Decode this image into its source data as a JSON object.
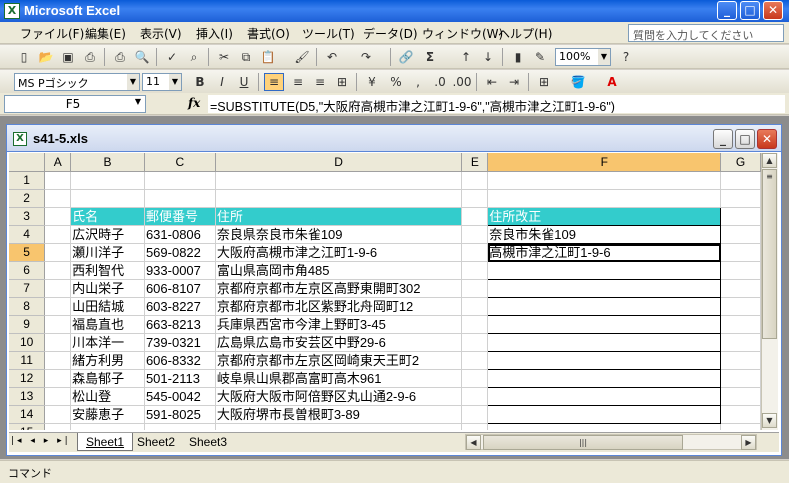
{
  "app": {
    "title": "Microsoft Excel",
    "help_placeholder": "質問を入力してください"
  },
  "menu": [
    "ファイル(F)",
    "編集(E)",
    "表示(V)",
    "挿入(I)",
    "書式(O)",
    "ツール(T)",
    "データ(D)",
    "ウィンドウ(W)",
    "ヘルプ(H)"
  ],
  "toolbar": {
    "zoom": "100%",
    "font_name": "MS Pゴシック",
    "font_size": "11"
  },
  "formula_bar": {
    "name_box": "F5",
    "fx": "fx",
    "formula": "=SUBSTITUTE(D5,\"大阪府高槻市津之江町1-9-6\",\"高槻市津之江町1-9-6\")"
  },
  "workbook": {
    "filename": "s41-5.xls"
  },
  "grid": {
    "columns": [
      "A",
      "B",
      "C",
      "D",
      "E",
      "F",
      "G"
    ],
    "selected_column": "F",
    "selected_row": "5",
    "headers": {
      "B": "氏名",
      "C": "郵便番号",
      "D": "住所",
      "F": "住所改正"
    },
    "rows": [
      {
        "n": "1",
        "B": "",
        "C": "",
        "D": "",
        "F": ""
      },
      {
        "n": "2",
        "B": "",
        "C": "",
        "D": "",
        "F": ""
      },
      {
        "n": "3",
        "B": "氏名",
        "C": "郵便番号",
        "D": "住所",
        "F": "住所改正"
      },
      {
        "n": "4",
        "B": "広沢時子",
        "C": "631-0806",
        "D": "奈良県奈良市朱雀109",
        "F": "奈良市朱雀109"
      },
      {
        "n": "5",
        "B": "瀬川洋子",
        "C": "569-0822",
        "D": "大阪府高槻市津之江町1-9-6",
        "F": "高槻市津之江町1-9-6"
      },
      {
        "n": "6",
        "B": "西利智代",
        "C": "933-0007",
        "D": "富山県高岡市角485",
        "F": ""
      },
      {
        "n": "7",
        "B": "内山栄子",
        "C": "606-8107",
        "D": "京都府京都市左京区高野東開町302",
        "F": ""
      },
      {
        "n": "8",
        "B": "山田結城",
        "C": "603-8227",
        "D": "京都府京都市北区紫野北舟岡町12",
        "F": ""
      },
      {
        "n": "9",
        "B": "福島直也",
        "C": "663-8213",
        "D": "兵庫県西宮市今津上野町3-45",
        "F": ""
      },
      {
        "n": "10",
        "B": "川本洋一",
        "C": "739-0321",
        "D": "広島県広島市安芸区中野29-6",
        "F": ""
      },
      {
        "n": "11",
        "B": "緒方利男",
        "C": "606-8332",
        "D": "京都府京都市左京区岡崎東天王町2",
        "F": ""
      },
      {
        "n": "12",
        "B": "森島郁子",
        "C": "501-2113",
        "D": "岐阜県山県郡高富町高木961",
        "F": ""
      },
      {
        "n": "13",
        "B": "松山登",
        "C": "545-0042",
        "D": "大阪府大阪市阿倍野区丸山通2-9-6",
        "F": ""
      },
      {
        "n": "14",
        "B": "安藤恵子",
        "C": "591-8025",
        "D": "大阪府堺市長曽根町3-89",
        "F": ""
      },
      {
        "n": "15",
        "B": "",
        "C": "",
        "D": "",
        "F": ""
      }
    ]
  },
  "sheet_tabs": [
    "Sheet1",
    "Sheet2",
    "Sheet3"
  ],
  "status": {
    "mode": "コマンド"
  },
  "colors": {
    "header_fill": "#33cccc",
    "selected_header": "#f8c56e",
    "titlebar": "#0a5bd8"
  }
}
